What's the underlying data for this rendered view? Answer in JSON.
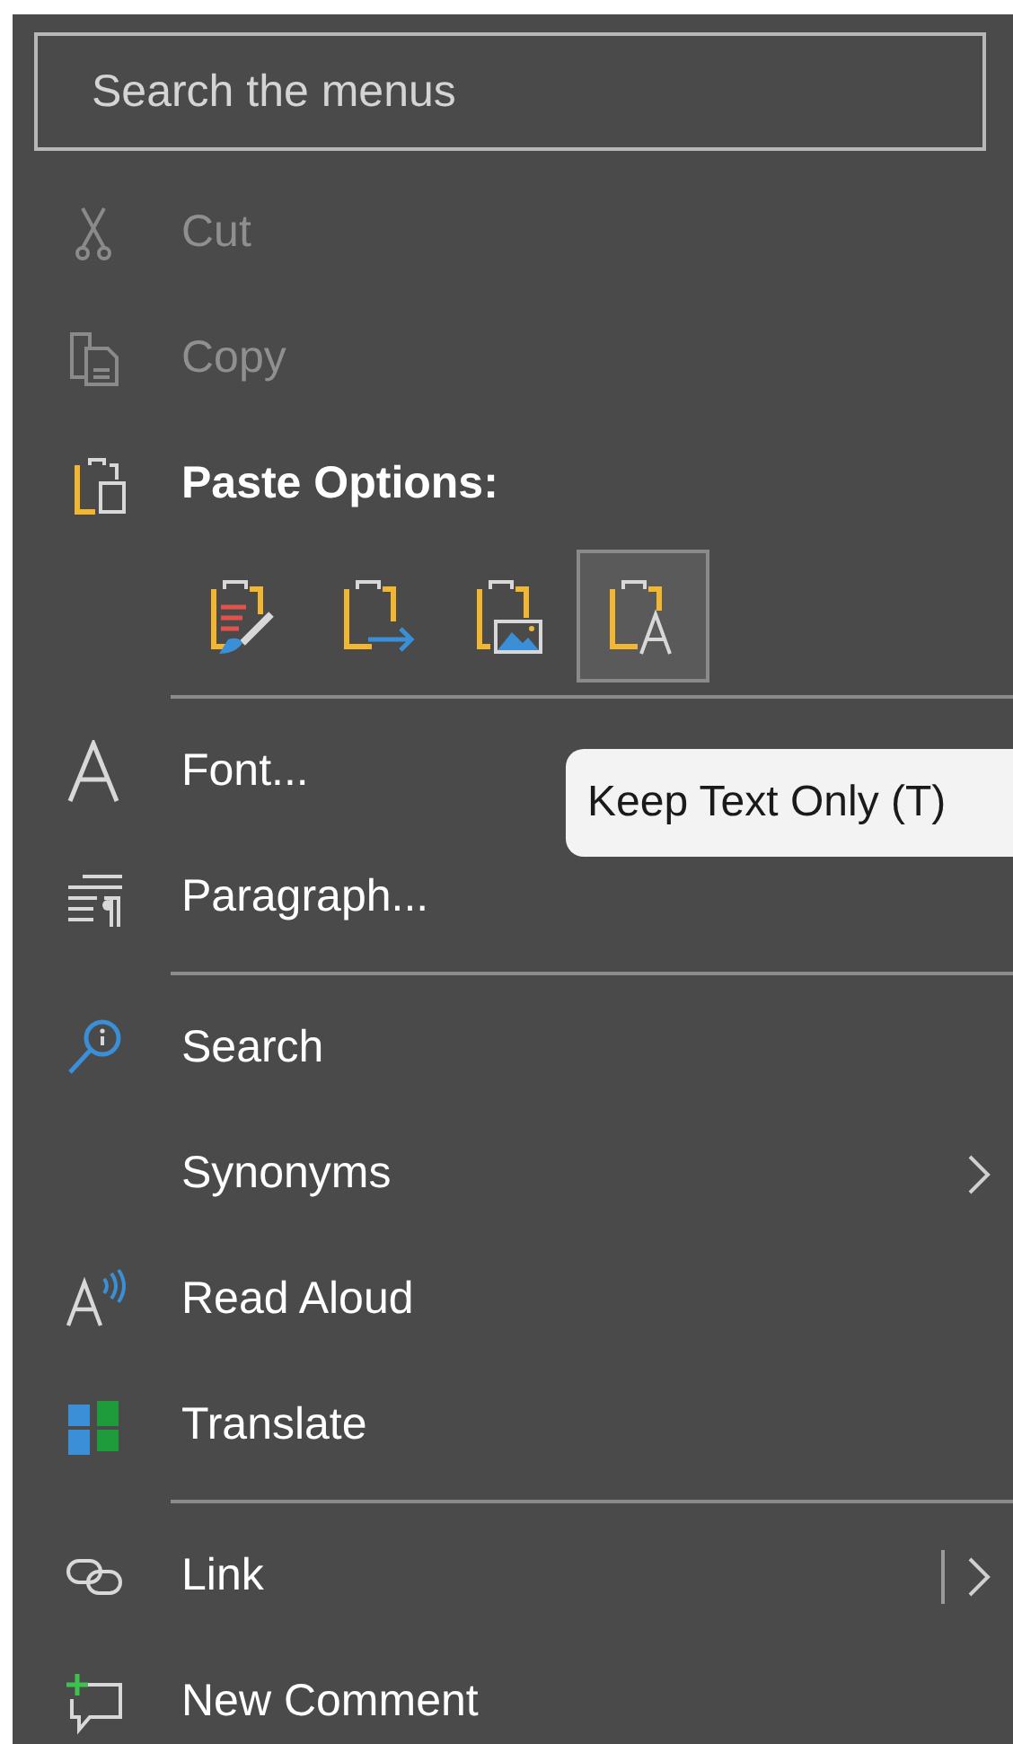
{
  "search": {
    "placeholder": "Search the menus"
  },
  "items": [
    {
      "kind": "command",
      "label": "Cut",
      "disabled": true
    },
    {
      "kind": "command",
      "label": "Copy",
      "disabled": true
    },
    {
      "kind": "header",
      "label": "Paste Options:"
    },
    {
      "kind": "paste_options",
      "options": [
        {
          "selected": false
        },
        {
          "selected": false
        },
        {
          "selected": false
        },
        {
          "selected": true
        }
      ]
    },
    {
      "kind": "separator"
    },
    {
      "kind": "command",
      "label": "Font...",
      "disabled": false
    },
    {
      "kind": "command",
      "label": "Paragraph...",
      "disabled": false
    },
    {
      "kind": "separator"
    },
    {
      "kind": "command",
      "label": "Search",
      "disabled": false
    },
    {
      "kind": "command",
      "label": "Synonyms",
      "disabled": false,
      "submenu": true
    },
    {
      "kind": "command",
      "label": "Read Aloud",
      "disabled": false
    },
    {
      "kind": "command",
      "label": "Translate",
      "disabled": false
    },
    {
      "kind": "separator"
    },
    {
      "kind": "command",
      "label": "Link",
      "disabled": false,
      "submenu": true,
      "split": true
    },
    {
      "kind": "command",
      "label": "New Comment",
      "disabled": false
    }
  ],
  "tooltip": {
    "text": "Keep Text Only (T)"
  }
}
